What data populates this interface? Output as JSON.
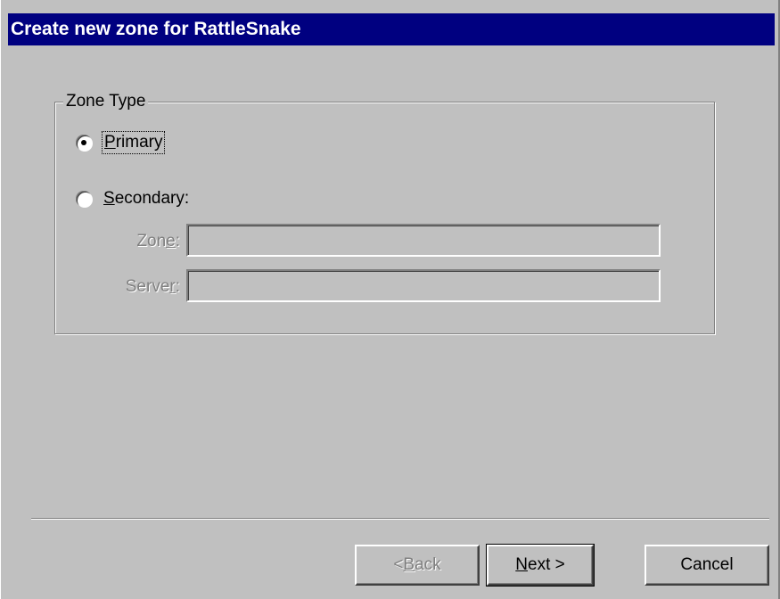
{
  "window": {
    "title": "Create new zone for RattleSnake"
  },
  "zone_type_group": {
    "legend": "Zone Type",
    "options": [
      {
        "label_pre": "",
        "label_key": "P",
        "label_post": "rimary",
        "checked": true
      },
      {
        "label_pre": "",
        "label_key": "S",
        "label_post": "econdary:",
        "checked": false
      }
    ],
    "zone_field": {
      "label_pre": "Zon",
      "label_key": "e",
      "label_post": ":",
      "value": ""
    },
    "server_field": {
      "label_pre": "Serve",
      "label_key": "r",
      "label_post": ":",
      "value": ""
    }
  },
  "buttons": {
    "back": {
      "pre": "< ",
      "key": "B",
      "post": "ack",
      "enabled": false
    },
    "next": {
      "pre": "",
      "key": "N",
      "post": "ext >",
      "enabled": true
    },
    "cancel": {
      "label": "Cancel",
      "enabled": true
    }
  }
}
